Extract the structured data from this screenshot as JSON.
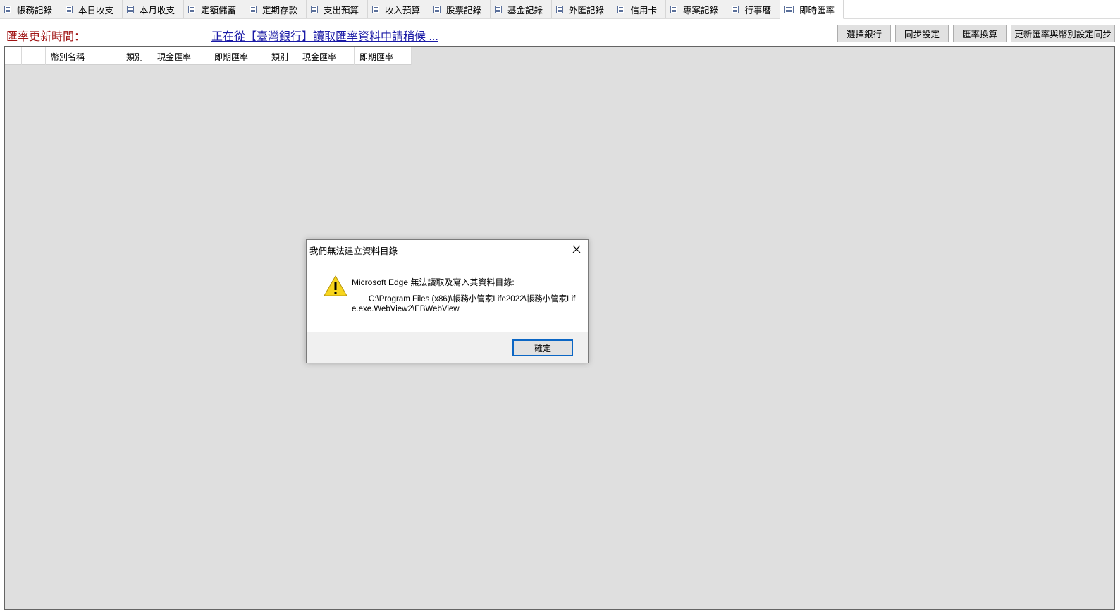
{
  "tabs": [
    {
      "label": "帳務記錄"
    },
    {
      "label": "本日收支"
    },
    {
      "label": "本月收支"
    },
    {
      "label": "定額儲蓄"
    },
    {
      "label": "定期存款"
    },
    {
      "label": "支出預算"
    },
    {
      "label": "收入預算"
    },
    {
      "label": "股票記錄"
    },
    {
      "label": "基金記錄"
    },
    {
      "label": "外匯記錄"
    },
    {
      "label": "信用卡"
    },
    {
      "label": "專案記錄"
    },
    {
      "label": "行事曆"
    },
    {
      "label": "即時匯率",
      "active": true
    }
  ],
  "infobar": {
    "update_label": "匯率更新時間：",
    "status_link": "正在從【臺灣銀行】讀取匯率資料中請稍候 ..."
  },
  "toolbar": {
    "select_bank": "選擇銀行",
    "sync_settings": "同步設定",
    "convert": "匯率換算",
    "update_sync": "更新匯率與幣別設定同步"
  },
  "grid": {
    "columns": [
      "",
      "",
      "幣別名稱",
      "類別",
      "現金匯率",
      "即期匯率",
      "類別",
      "現金匯率",
      "即期匯率"
    ]
  },
  "dialog": {
    "title": "我們無法建立資料目錄",
    "message": "Microsoft Edge 無法讀取及寫入其資料目錄:",
    "path": "C:\\Program Files (x86)\\帳務小管家Life2022\\帳務小管家Life.exe.WebView2\\EBWebView",
    "ok_label": "確定",
    "icon": "warning-icon"
  }
}
